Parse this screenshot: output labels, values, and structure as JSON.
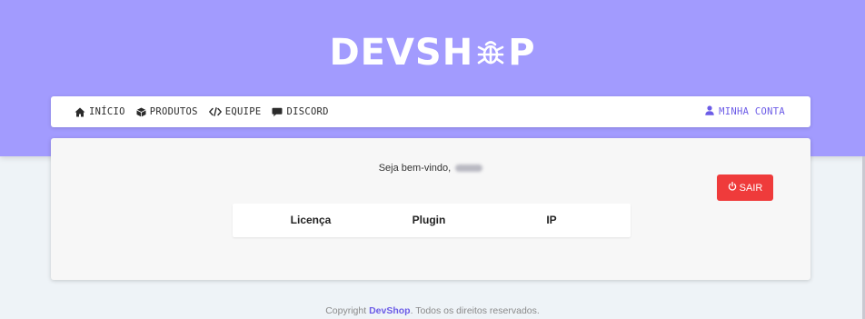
{
  "brand": {
    "part1": "DEVSH",
    "icon": "bug-icon",
    "part2": "P"
  },
  "nav": {
    "items": [
      {
        "label": "INÍCIO",
        "icon": "home-icon"
      },
      {
        "label": "PRODUTOS",
        "icon": "cube-icon"
      },
      {
        "label": "EQUIPE",
        "icon": "code-icon"
      },
      {
        "label": "DISCORD",
        "icon": "chat-icon"
      }
    ],
    "account": {
      "label": "MINHA CONTA",
      "icon": "user-icon"
    }
  },
  "main": {
    "welcome": "Seja bem-vindo,",
    "logout_label": "SAIR",
    "table_headers": [
      "Licença",
      "Plugin",
      "IP"
    ]
  },
  "footer": {
    "prefix": "Copyright ",
    "brand": "DevShop",
    "suffix": ". Todos os direitos reservados."
  },
  "colors": {
    "hero": "#a29bfe",
    "accent": "#6c5ce7",
    "danger": "#ef3b3b"
  }
}
